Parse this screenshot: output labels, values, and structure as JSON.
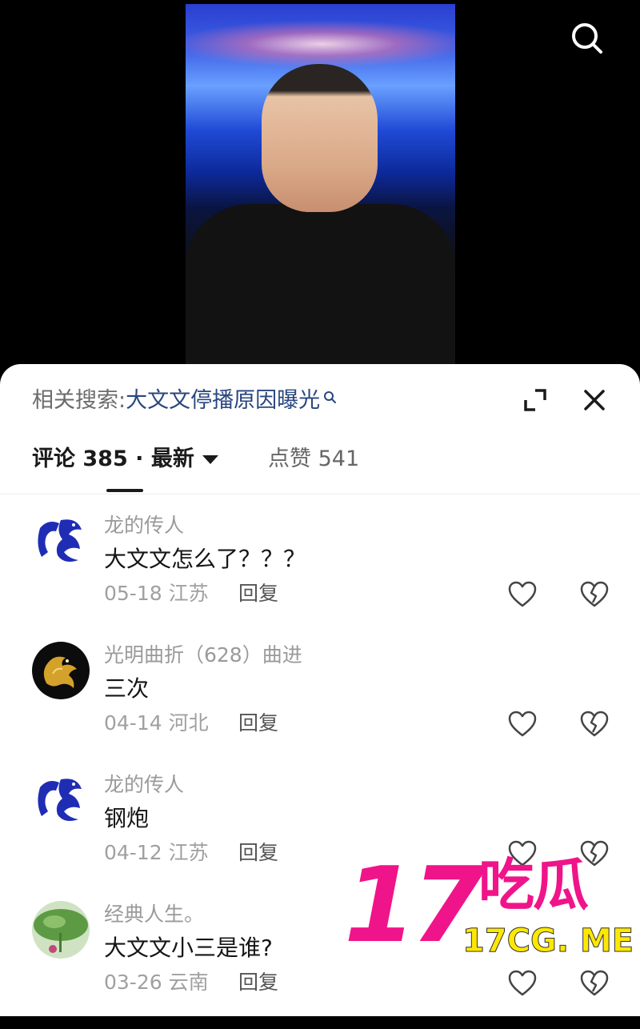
{
  "related_search": {
    "prefix": "相关搜索:",
    "keyword": "大文文停播原因曝光"
  },
  "tabs": {
    "comments_label": "评论 385 · 最新",
    "likes_label": "点赞 541"
  },
  "comments": [
    {
      "name": "龙的传人",
      "text": "大文文怎么了？？？",
      "date": "05-18",
      "location": "江苏",
      "reply": "回复",
      "avatar": "dragon-logo"
    },
    {
      "name": "光明曲折（628）曲进",
      "text": "三次",
      "date": "04-14",
      "location": "河北",
      "reply": "回复",
      "avatar": "golden-dragon"
    },
    {
      "name": "龙的传人",
      "text": "钢炮",
      "date": "04-12",
      "location": "江苏",
      "reply": "回复",
      "avatar": "dragon-logo"
    },
    {
      "name": "经典人生。",
      "text": "大文文小三是谁?",
      "date": "03-26",
      "location": "云南",
      "reply": "回复",
      "avatar": "lotus-leaf"
    }
  ],
  "watermark": {
    "number": "17",
    "chinese": "吃瓜",
    "domain": "17CG. ME",
    "color": "#f0148a",
    "domain_color": "#ffe800"
  },
  "colors": {
    "keyword": "#29467f",
    "sheet_bg": "#ffffff",
    "page_bg": "#000000"
  }
}
